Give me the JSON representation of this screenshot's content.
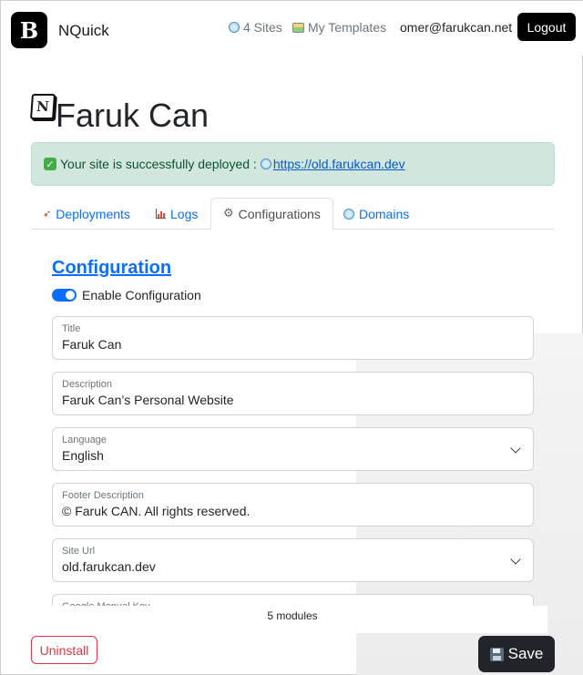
{
  "navbar": {
    "logo_letter": "B",
    "brand": "NQuick",
    "sites_link": "4 Sites",
    "templates_link": "My Templates",
    "user_email": "omer@farukcan.net",
    "logout_label": "Logout"
  },
  "site": {
    "notion_letter": "N",
    "title": "Faruk Can"
  },
  "alert": {
    "check": "✓",
    "message": "Your site is successfully deployed :",
    "url": "https://old.farukcan.dev"
  },
  "tabs": [
    {
      "label": "Deployments",
      "active": false
    },
    {
      "label": "Logs",
      "active": false
    },
    {
      "label": "Configurations",
      "active": true
    },
    {
      "label": "Domains",
      "active": false
    }
  ],
  "config": {
    "heading": "Configuration",
    "toggle_label": "Enable Configuration",
    "toggle_on": true,
    "fields": [
      {
        "label": "Title",
        "value": "Faruk Can"
      },
      {
        "label": "Description",
        "value": "Faruk Can’s Personal Website"
      },
      {
        "label": "Language",
        "value": "English"
      },
      {
        "label": "Footer Description",
        "value": "© Faruk CAN. All rights reserved."
      },
      {
        "label": "Site Url",
        "value": "old.farukcan.dev"
      },
      {
        "label": "Google Manual Key",
        "value": ""
      }
    ]
  },
  "footer": {
    "modules_count": "5 modules",
    "uninstall_label": "Uninstall",
    "save_label": "Save"
  },
  "colors": {
    "accent": "#0d6efd",
    "success_bg": "#d1e7dd",
    "danger": "#dc3545",
    "dark": "#212529"
  }
}
